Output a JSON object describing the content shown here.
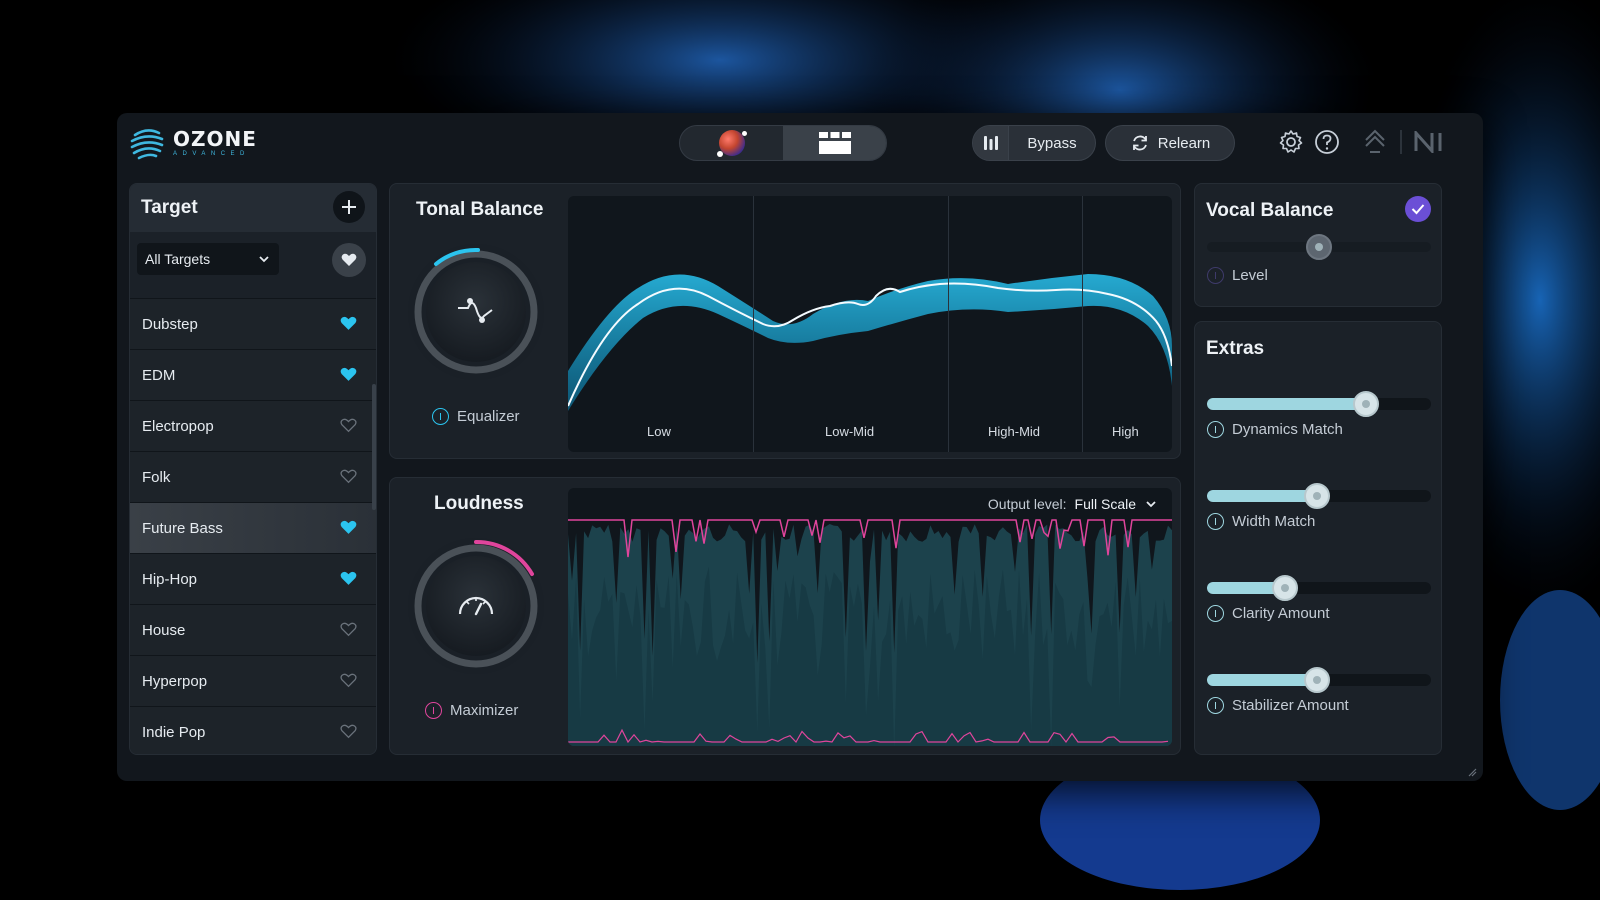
{
  "app": {
    "brand": "OZONE",
    "edition": "ADVANCED",
    "bypass_label": "Bypass",
    "relearn_label": "Relearn",
    "colors": {
      "accent_blue": "#2bc4ef",
      "accent_pink": "#e0459c",
      "accent_purple": "#6b4fd6",
      "slider_fill": "#9ed6e0"
    },
    "icons": [
      "settings-icon",
      "help-icon",
      "link-icon",
      "ni-logo-icon"
    ]
  },
  "target": {
    "title": "Target",
    "filter_value": "All Targets",
    "items": [
      {
        "label": "Dubstep",
        "favorite": true,
        "selected": false
      },
      {
        "label": "EDM",
        "favorite": true,
        "selected": false
      },
      {
        "label": "Electropop",
        "favorite": false,
        "selected": false
      },
      {
        "label": "Folk",
        "favorite": false,
        "selected": false
      },
      {
        "label": "Future Bass",
        "favorite": true,
        "selected": true
      },
      {
        "label": "Hip-Hop",
        "favorite": true,
        "selected": false
      },
      {
        "label": "House",
        "favorite": false,
        "selected": false
      },
      {
        "label": "Hyperpop",
        "favorite": false,
        "selected": false
      },
      {
        "label": "Indie Pop",
        "favorite": false,
        "selected": false
      }
    ]
  },
  "tonal_balance": {
    "title": "Tonal Balance",
    "module_label": "Equalizer",
    "bands": [
      "Low",
      "Low-Mid",
      "High-Mid",
      "High"
    ]
  },
  "loudness": {
    "title": "Loudness",
    "module_label": "Maximizer",
    "output_label": "Output level:",
    "output_value": "Full Scale"
  },
  "vocal_balance": {
    "title": "Vocal Balance",
    "enabled": true,
    "level_label": "Level",
    "level_value": 0.5
  },
  "extras": {
    "title": "Extras",
    "sliders": [
      {
        "label": "Dynamics Match",
        "value": 0.71
      },
      {
        "label": "Width Match",
        "value": 0.49
      },
      {
        "label": "Clarity Amount",
        "value": 0.35
      },
      {
        "label": "Stabilizer Amount",
        "value": 0.49
      }
    ]
  }
}
